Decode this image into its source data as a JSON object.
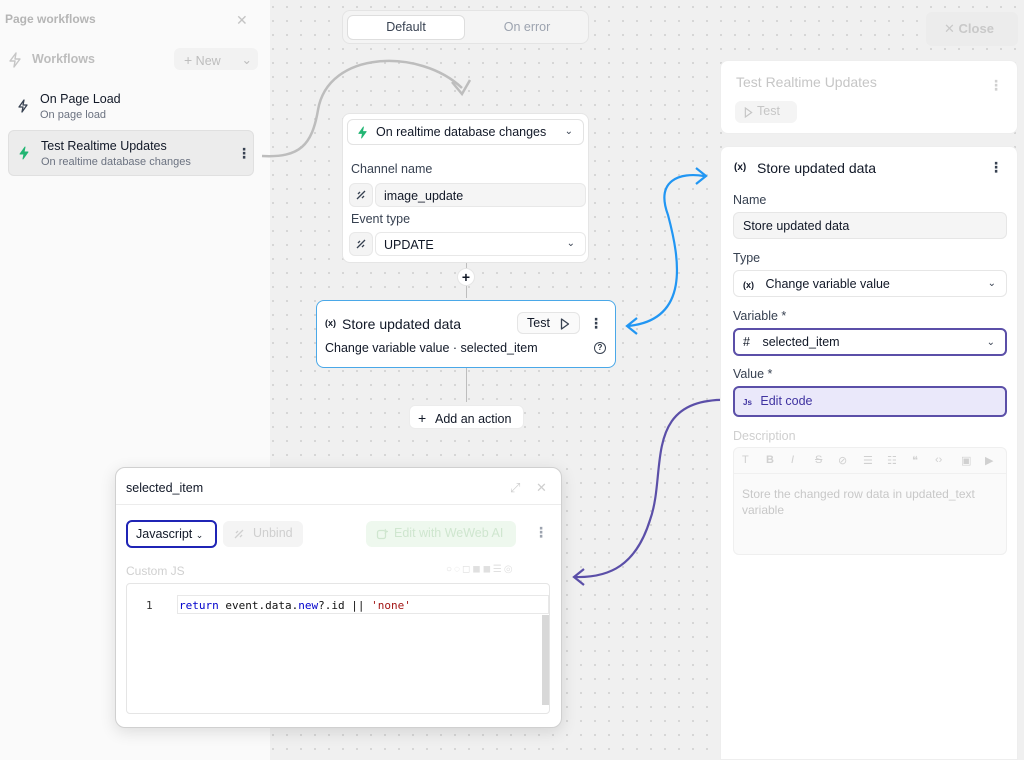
{
  "sidebar": {
    "title": "Page workflows",
    "section_label": "Workflows",
    "new_button": "New",
    "items": [
      {
        "title": "On Page Load",
        "subtitle": "On page load"
      },
      {
        "title": "Test Realtime Updates",
        "subtitle": "On realtime database changes"
      }
    ]
  },
  "canvas": {
    "toggle": {
      "default": "Default",
      "on_error": "On error"
    },
    "close_button": "Close",
    "trigger": {
      "label": "On realtime database changes",
      "channel_label": "Channel name",
      "channel_value": "image_update",
      "event_label": "Event type",
      "event_value": "UPDATE"
    },
    "action": {
      "icon_text": "(x)",
      "title": "Store updated data",
      "test_label": "Test",
      "subtitle": "Change variable value · selected_item"
    },
    "add_action": "Add an action"
  },
  "right_panel": {
    "workflow_title": "Test Realtime Updates",
    "test_label": "Test",
    "action_title": "Store updated data",
    "action_icon_text": "(x)",
    "name_label": "Name",
    "name_value": "Store updated data",
    "type_label": "Type",
    "type_value": "Change variable value",
    "variable_label": "Variable *",
    "variable_value": "selected_item",
    "value_label": "Value *",
    "value_code": "Edit code",
    "value_code_icon": "Js",
    "description_label": "Description",
    "description_placeholder": "Store the changed row data in updated_text variable"
  },
  "code_popup": {
    "title": "selected_item",
    "language": "Javascript",
    "unbind": "Unbind",
    "ai_button": "Edit with WeWeb AI",
    "custom_js_label": "Custom JS",
    "line_number": "1",
    "code": {
      "kw1": "return",
      "p1": " event.data.",
      "kw2": "new",
      "p2": "?.id || ",
      "str": "'none'"
    }
  },
  "colors": {
    "accent_blue": "#2196f3",
    "accent_purple": "#5b4fa8",
    "trigger_green": "#22b573",
    "action_border": "#4aa8e8"
  }
}
